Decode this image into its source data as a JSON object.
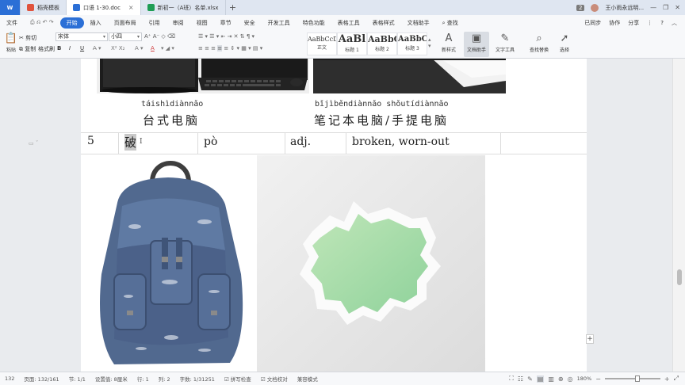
{
  "tabs": {
    "home": "W",
    "items": [
      {
        "label": "稻壳模板",
        "color": "#e0533d",
        "active": false
      },
      {
        "label": "口语 1-30.doc",
        "color": "#2b6fd6",
        "active": true
      },
      {
        "label": "新初一（A班）名单.xlsx",
        "color": "#1f9d55",
        "active": false
      }
    ],
    "add": "+",
    "right": {
      "count": "2",
      "user": "王小雨永远明...",
      "minimize": "—",
      "maximize": "❐",
      "close": "✕"
    }
  },
  "menu": {
    "items": [
      "文件",
      "开始",
      "插入",
      "页面布局",
      "引用",
      "审阅",
      "视图",
      "章节",
      "安全",
      "开发工具",
      "特色功能",
      "表格工具",
      "表格样式",
      "文档助手"
    ],
    "active_index": 1,
    "search": "查找",
    "right": [
      "已同步",
      "协作",
      "分享"
    ]
  },
  "ribbon": {
    "paste": "粘贴",
    "cut": "剪切",
    "copy": "复制",
    "format_painter": "格式刷",
    "font_name": "宋体",
    "font_size": "小四",
    "styles": [
      {
        "sample": "AaBbCcDd",
        "name": "正文"
      },
      {
        "sample": "AaBl",
        "name": "标题 1"
      },
      {
        "sample": "AaBbC",
        "name": "标题 2"
      },
      {
        "sample": "AaBbC",
        "name": "标题 3"
      }
    ],
    "new_style": "新样式",
    "doc_helper": "文档助手",
    "text_tools": "文字工具",
    "find_replace": "查找替换",
    "select": "选择"
  },
  "document": {
    "row4": {
      "left_pinyin": "táishìdiànnǎo",
      "left_hanzi": "台式电脑",
      "right_pinyin": "bǐjìběndiànnǎo shǒutídiànnǎo",
      "right_hanzi": "笔记本电脑/手提电脑"
    },
    "row5": {
      "num": "5",
      "hanzi": "破",
      "pinyin": "pò",
      "pos": "adj.",
      "meaning": "broken, worn-out"
    },
    "left_marker": "▭ ˇ",
    "plus": "+"
  },
  "status": {
    "page_num": "132",
    "page": "页面: 132/161",
    "section": "节: 1/1",
    "setting": "设置值: 8厘米",
    "line": "行: 1",
    "column": "列: 2",
    "words": "字数: 1/31251",
    "spell_check": "拼写检查",
    "doc_check": "文档校对",
    "compat_mode": "兼容模式",
    "zoom": "180%",
    "zoom_fraction": 0.6
  }
}
